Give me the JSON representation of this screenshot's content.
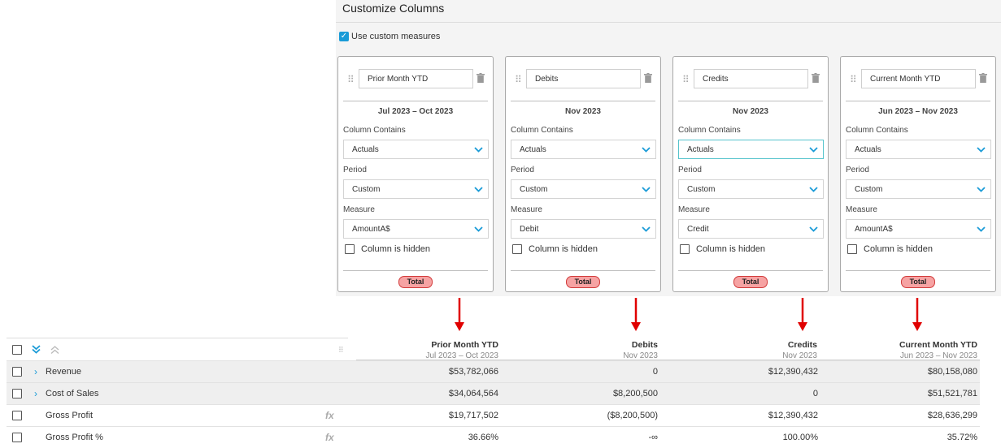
{
  "panel": {
    "title": "Customize Columns",
    "use_custom_measures_label": "Use custom measures"
  },
  "labels": {
    "column_contains": "Column Contains",
    "period": "Period",
    "measure": "Measure",
    "column_is_hidden": "Column is hidden",
    "total_badge": "Total"
  },
  "cards": [
    {
      "name": "Prior Month YTD",
      "date_range": "Jul 2023 – Oct 2023",
      "contains": "Actuals",
      "period": "Custom",
      "measure": "AmountA$"
    },
    {
      "name": "Debits",
      "date_range": "Nov 2023",
      "contains": "Actuals",
      "period": "Custom",
      "measure": "Debit"
    },
    {
      "name": "Credits",
      "date_range": "Nov 2023",
      "contains": "Actuals",
      "period": "Custom",
      "measure": "Credit"
    },
    {
      "name": "Current Month YTD",
      "date_range": "Jun 2023 – Nov 2023",
      "contains": "Actuals",
      "period": "Custom",
      "measure": "AmountA$"
    }
  ],
  "grid": {
    "columns": [
      {
        "title": "Prior Month YTD",
        "sub": "Jul 2023 – Oct 2023"
      },
      {
        "title": "Debits",
        "sub": "Nov 2023"
      },
      {
        "title": "Credits",
        "sub": "Nov 2023"
      },
      {
        "title": "Current Month YTD",
        "sub": "Jun 2023 – Nov 2023"
      }
    ],
    "rows": [
      {
        "label": "Revenue",
        "values": [
          "$53,782,066",
          "0",
          "$12,390,432",
          "$80,158,080"
        ]
      },
      {
        "label": "Cost of Sales",
        "values": [
          "$34,064,564",
          "$8,200,500",
          "0",
          "$51,521,781"
        ]
      },
      {
        "label": "Gross Profit",
        "fx": "fx",
        "values": [
          "$19,717,502",
          "($8,200,500)",
          "$12,390,432",
          "$28,636,299"
        ]
      },
      {
        "label": "Gross Profit %",
        "fx": "fx",
        "values": [
          "36.66%",
          "-∞",
          "100.00%",
          "35.72%"
        ]
      }
    ]
  },
  "colors": {
    "accent": "#1a9bd7",
    "arrow": "#e00000",
    "badge_fill": "#f6a3a3",
    "badge_border": "#d23a3a"
  }
}
